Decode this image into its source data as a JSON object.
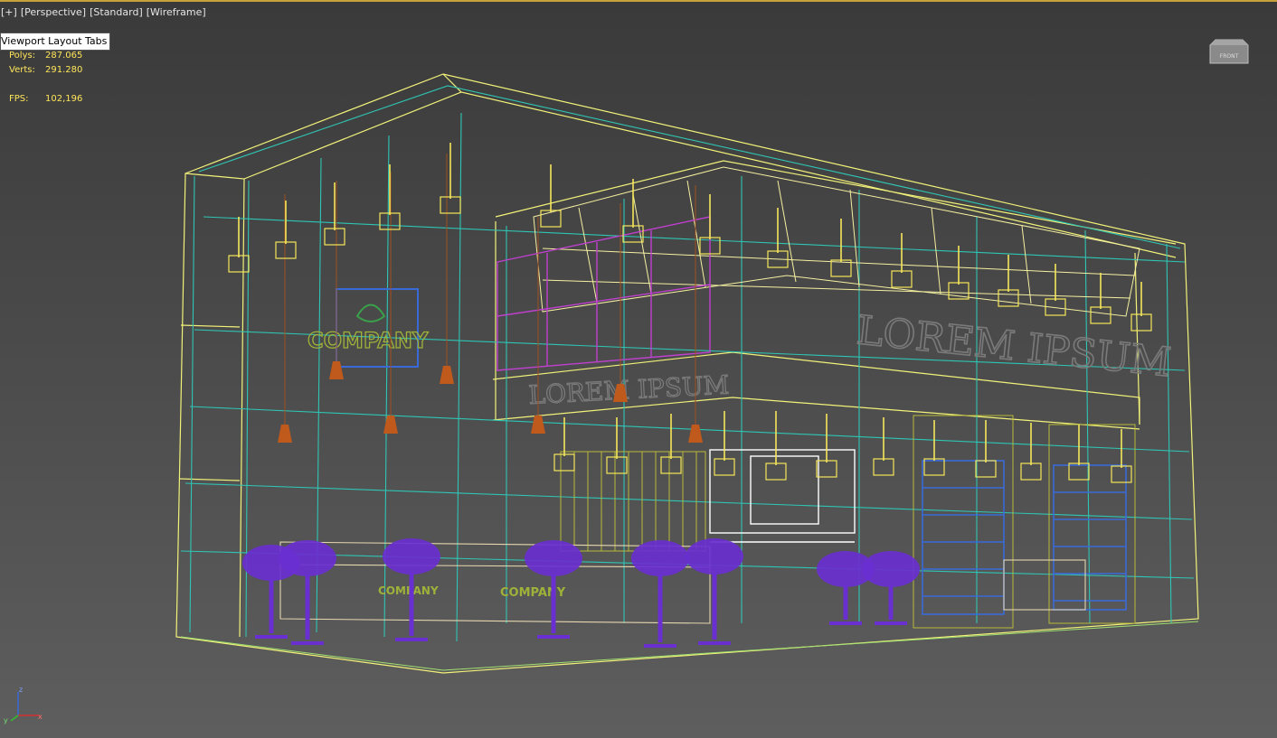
{
  "viewport_labels": {
    "plus": "[+]",
    "view": "[Perspective]",
    "shading_standard": "[Standard]",
    "shading_mode": "[Wireframe]"
  },
  "tooltip": {
    "text": "Viewport Layout Tabs"
  },
  "stats": {
    "polys_label": "Polys:",
    "polys_value": "287.065",
    "verts_label": "Verts:",
    "verts_value": "291.280",
    "fps_label": "FPS:",
    "fps_value": "102,196"
  },
  "scene_text": {
    "company_logo_text": "COMPANY",
    "lorem_back": "LOREM IPSUM",
    "lorem_center": "LOREM IPSUM"
  },
  "viewcube": {
    "label": "FRONT"
  },
  "axis": {
    "x": "x",
    "y": "y",
    "z": "z"
  },
  "colors": {
    "frame_yellow": "#f2f27a",
    "frame_teal": "#2fc5b4",
    "lamp_yellow": "#f5e65a",
    "pendant_brown": "#c0591c",
    "chair_purple": "#6a2fd0",
    "magenta": "#c040d0",
    "blue_shelf": "#3a6ad8",
    "olive_text": "#9eb23a",
    "grey_text": "#6e6e6e",
    "stats_yellow": "#ffe65a",
    "accent_gold": "#c8a13a"
  }
}
